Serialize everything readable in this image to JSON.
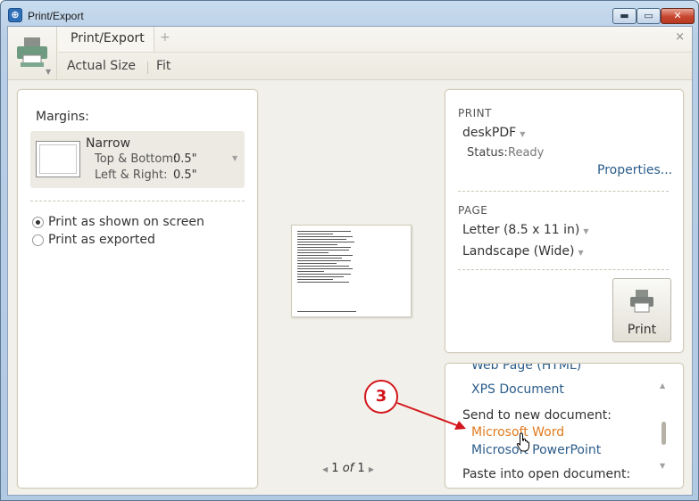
{
  "window": {
    "title": "Print/Export",
    "controls": {
      "minimize": "▬",
      "maximize": "▭",
      "close": "✕"
    }
  },
  "toolbar": {
    "tab_label": "Print/Export",
    "add_tab": "+",
    "close_tab": "×",
    "actual_size_label": "Actual Size",
    "fit_label": "Fit"
  },
  "margins": {
    "label": "Margins:",
    "preset_name": "Narrow",
    "top_bottom_label": "Top & Bottom:",
    "top_bottom_value": "0.5\"",
    "left_right_label": "Left & Right:",
    "left_right_value": "0.5\""
  },
  "print_mode": {
    "options": [
      {
        "label": "Print as shown on screen",
        "selected": true
      },
      {
        "label": "Print as exported",
        "selected": false
      }
    ]
  },
  "preview": {
    "current_page": "1",
    "of_label": "of",
    "total_pages": "1"
  },
  "print_panel": {
    "section_print": "PRINT",
    "printer": "deskPDF",
    "status_label": "Status:",
    "status_value": "Ready",
    "properties_link": "Properties...",
    "section_page": "PAGE",
    "paper_size": "Letter (8.5 x 11 in)",
    "orientation": "Landscape (Wide)",
    "print_button": "Print"
  },
  "export_panel": {
    "partial_top_item": "Web Page (HTML)",
    "xps_item": "XPS Document",
    "send_to_new_heading": "Send to new document:",
    "word_item": "Microsoft Word",
    "powerpoint_item": "Microsoft PowerPoint",
    "paste_heading": "Paste into open document:"
  },
  "annotation": {
    "callout_number": "3"
  },
  "colors": {
    "accent_link": "#2b5c8a",
    "hover_link": "#e07b1f",
    "callout_red": "#d2161b"
  }
}
